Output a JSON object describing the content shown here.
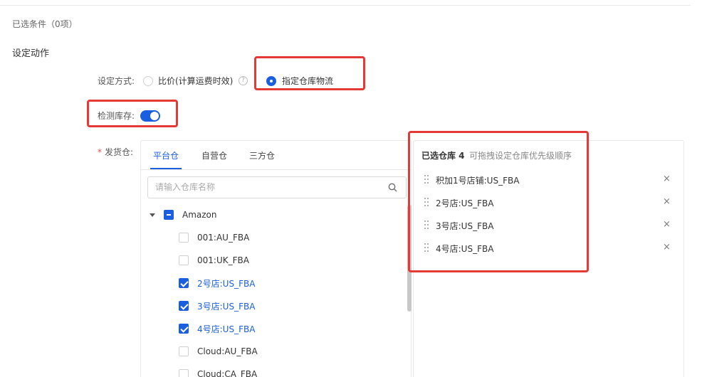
{
  "selected_conditions": "已选条件（0项）",
  "section_title": "设定动作",
  "form": {
    "mode_label": "设定方式:",
    "mode_option_1": "比价(计算运费时效)",
    "mode_option_2": "指定仓库物流",
    "help_icon": "?",
    "check_stock_label": "检测库存:",
    "required_mark": "*",
    "ship_label": "发货仓:"
  },
  "warehouse_tabs": [
    "平台仓",
    "自营仓",
    "三方仓"
  ],
  "search": {
    "placeholder": "请输入仓库名称"
  },
  "tree": {
    "group": "Amazon",
    "items": [
      {
        "label": "001:AU_FBA",
        "checked": false
      },
      {
        "label": "001:UK_FBA",
        "checked": false
      },
      {
        "label": "2号店:US_FBA",
        "checked": true
      },
      {
        "label": "3号店:US_FBA",
        "checked": true
      },
      {
        "label": "4号店:US_FBA",
        "checked": true
      },
      {
        "label": "Cloud:AU_FBA",
        "checked": false
      },
      {
        "label": "Cloud:CA_FBA",
        "checked": false
      }
    ]
  },
  "selected_panel": {
    "title": "已选仓库 4",
    "hint": "可拖拽设定仓库优先级顺序",
    "close_icon": "×",
    "items": [
      "积加1号店铺:US_FBA",
      "2号店:US_FBA",
      "3号店:US_FBA",
      "4号店:US_FBA"
    ]
  },
  "colors": {
    "accent": "#1a5fe0",
    "highlight_box": "#e53935",
    "required": "#e5484d"
  }
}
